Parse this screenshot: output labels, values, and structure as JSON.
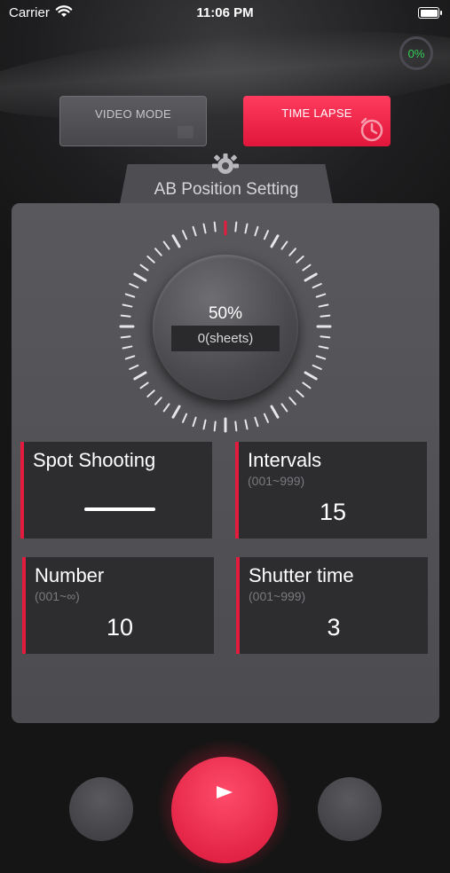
{
  "status_bar": {
    "carrier": "Carrier",
    "time": "11:06 PM",
    "icons": [
      "wifi-icon",
      "battery-icon"
    ]
  },
  "battery_badge": {
    "label": "0%",
    "color": "#34d058"
  },
  "modes": {
    "video_label": "VIDEO MODE",
    "timelapse_label": "TIME LAPSE",
    "active": "TIME LAPSE",
    "active_color": "#ff2d55",
    "timelapse_icon": "timer-icon"
  },
  "ab_setting": {
    "label": "AB Position Setting",
    "icon": "gear-icon"
  },
  "dial": {
    "percent_label": "50%",
    "progress": 0.5,
    "sheets_label": "0(sheets)",
    "accent": "#e31b3c"
  },
  "cards": {
    "spot_shooting": {
      "title": "Spot Shooting"
    },
    "intervals": {
      "title": "Intervals",
      "range": "(001~999)",
      "value": "15"
    },
    "number": {
      "title": "Number",
      "range": "(001~∞)",
      "value": "10"
    },
    "shutter_time": {
      "title": "Shutter time",
      "range": "(001~999)",
      "value": "3"
    }
  },
  "controls": {
    "left_icon": "left-control-icon",
    "center_icon": "play-icon",
    "right_icon": "right-control-icon"
  }
}
